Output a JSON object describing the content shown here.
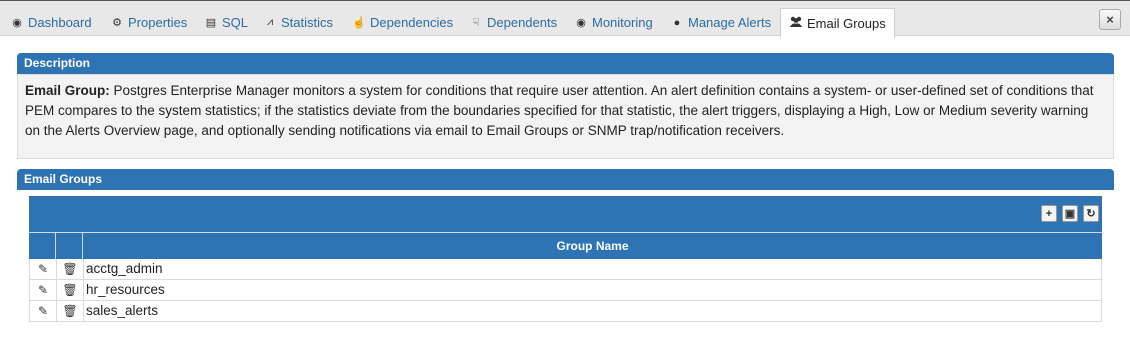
{
  "tabs": [
    {
      "label": "Dashboard",
      "icon": "dashboard-icon",
      "glyph": "◉"
    },
    {
      "label": "Properties",
      "icon": "cogs-icon",
      "glyph": "⚙"
    },
    {
      "label": "SQL",
      "icon": "file-icon",
      "glyph": "▤"
    },
    {
      "label": "Statistics",
      "icon": "line-chart-icon",
      "glyph": "⩘"
    },
    {
      "label": "Dependencies",
      "icon": "hand-pointer-icon",
      "glyph": "☝"
    },
    {
      "label": "Dependents",
      "icon": "hand-pointer-icon",
      "glyph": "☟"
    },
    {
      "label": "Monitoring",
      "icon": "dashboard-icon",
      "glyph": "◉"
    },
    {
      "label": "Manage Alerts",
      "icon": "globe-icon",
      "glyph": "●"
    },
    {
      "label": "Email Groups",
      "icon": "users-icon",
      "glyph": "👥",
      "active": true
    }
  ],
  "close_label": "×",
  "description": {
    "header": "Description",
    "term": "Email Group:",
    "text": " Postgres Enterprise Manager monitors a system for conditions that require user attention. An alert definition contains a system- or user-defined set of conditions that PEM compares to the system statistics; if the statistics deviate from the boundaries specified for that statistic, the alert triggers, displaying a High, Low or Medium severity warning on the Alerts Overview page, and optionally sending notifications via email to Email Groups or SNMP trap/notification receivers."
  },
  "email_groups": {
    "header": "Email Groups",
    "toolbar": {
      "add": "+",
      "save": "▣",
      "refresh": "↻"
    },
    "column_header": "Group Name",
    "rows": [
      {
        "name": "acctg_admin"
      },
      {
        "name": "hr_resources"
      },
      {
        "name": "sales_alerts"
      }
    ]
  },
  "colors": {
    "accent": "#2e74b5",
    "link": "#2d6ca2"
  }
}
